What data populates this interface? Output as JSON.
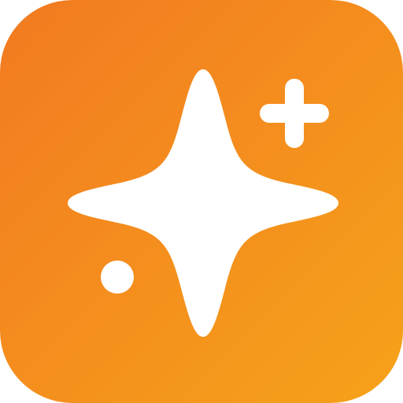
{
  "icon": {
    "name": "sparkle-app-icon",
    "background_gradient": {
      "from": "#F27A21",
      "to": "#F6A21A"
    },
    "foreground_color": "#FFFFFF",
    "glyphs": [
      "four-point-sparkle",
      "plus",
      "dot"
    ]
  }
}
